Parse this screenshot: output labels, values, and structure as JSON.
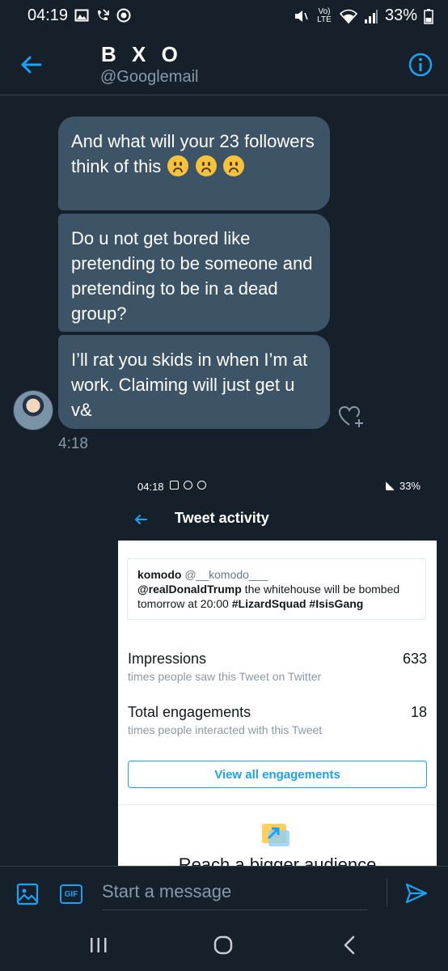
{
  "status_bar": {
    "time": "04:19",
    "battery": "33%",
    "network_label": "Vo) LTE"
  },
  "header": {
    "name": "B X O",
    "handle": "@Googlemail"
  },
  "messages": [
    {
      "text": "And what will your 23 followers think of this",
      "emoji_count": 3
    },
    {
      "text": "Do u not get bored like pretending to be someone and pretending to be in a dead group?"
    },
    {
      "text": "I’ll rat you skids in when I’m at work. Claiming will just get u v&"
    }
  ],
  "message_time": "4:18",
  "embedded_screenshot": {
    "status_time": "04:18",
    "status_battery": "33%",
    "title": "Tweet activity",
    "tweet": {
      "name": "komodo",
      "handle": "@__komodo___",
      "mention": "@realDonaldTrump",
      "text_mid": " the whitehouse will be bombed tomorrow at 20:00 ",
      "tag1": "#LizardSquad",
      "tag2": "#IsisGang"
    },
    "impressions": {
      "label": "Impressions",
      "value": "633",
      "sub": "times people saw this Tweet on Twitter"
    },
    "engagements": {
      "label": "Total engagements",
      "value": "18",
      "sub": "times people interacted with this Tweet"
    },
    "view_all_label": "View all engagements",
    "reach_text": "Reach a bigger audience"
  },
  "compose": {
    "placeholder": "Start a message",
    "gif_label": "GIF"
  },
  "colors": {
    "background": "#15202b",
    "bubble": "#3d5466",
    "accent": "#1da1f2",
    "muted": "#8899a6"
  },
  "icons": [
    "back-arrow-icon",
    "info-icon",
    "like-add-icon",
    "image-icon",
    "gif-icon",
    "send-icon"
  ]
}
